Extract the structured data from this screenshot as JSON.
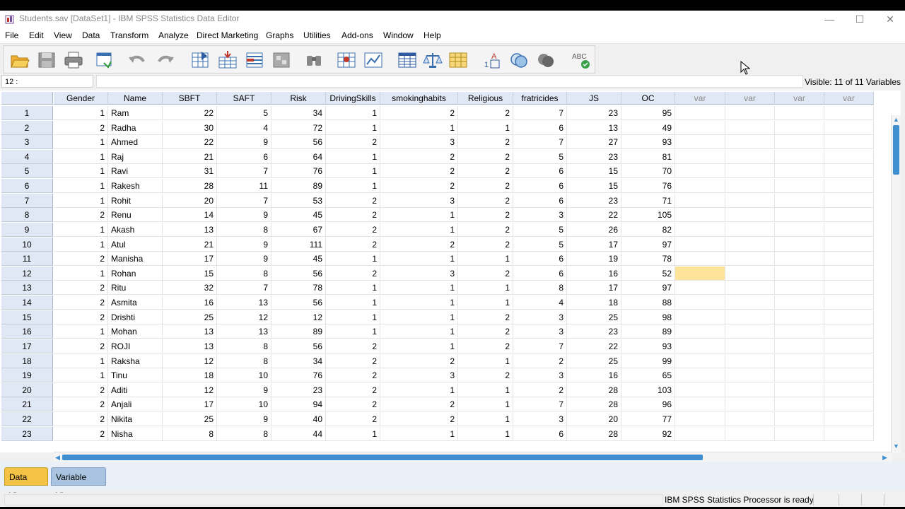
{
  "window": {
    "title": "Students.sav [DataSet1] - IBM SPSS Statistics Data Editor",
    "minimize": "—",
    "maximize": "☐",
    "close": "✕"
  },
  "menu": [
    "File",
    "Edit",
    "View",
    "Data",
    "Transform",
    "Analyze",
    "Direct Marketing",
    "Graphs",
    "Utilities",
    "Add-ons",
    "Window",
    "Help"
  ],
  "toolbar": {
    "icons": [
      "open-icon",
      "save-icon",
      "print-icon",
      "recall-dialog-icon",
      "undo-icon",
      "redo-icon",
      "goto-case-icon",
      "goto-variable-icon",
      "variables-icon",
      "run-descriptives-icon",
      "find-icon",
      "insert-cases-icon",
      "insert-variable-icon",
      "split-file-icon",
      "weight-cases-icon",
      "select-cases-icon",
      "value-labels-icon",
      "use-variable-sets-icon",
      "show-all-variables-icon",
      "spell-check-icon"
    ]
  },
  "cellbar": {
    "ref": "12 :",
    "value": "",
    "visible": "Visible: 11 of 11 Variables"
  },
  "grid": {
    "columns": [
      "Gender",
      "Name",
      "SBFT",
      "SAFT",
      "Risk",
      "DrivingSkills",
      "smokinghabits",
      "Religious",
      "fratricides",
      "JS",
      "OC",
      "var",
      "var",
      "var",
      "var"
    ],
    "rows": [
      [
        "1",
        "1",
        "Ram",
        "22",
        "5",
        "34",
        "1",
        "2",
        "2",
        "7",
        "23",
        "95"
      ],
      [
        "2",
        "2",
        "Radha",
        "30",
        "4",
        "72",
        "1",
        "1",
        "1",
        "6",
        "13",
        "49"
      ],
      [
        "3",
        "1",
        "Ahmed",
        "22",
        "9",
        "56",
        "2",
        "3",
        "2",
        "7",
        "27",
        "93"
      ],
      [
        "4",
        "1",
        "Raj",
        "21",
        "6",
        "64",
        "1",
        "2",
        "2",
        "5",
        "23",
        "81"
      ],
      [
        "5",
        "1",
        "Ravi",
        "31",
        "7",
        "76",
        "1",
        "2",
        "2",
        "6",
        "15",
        "70"
      ],
      [
        "6",
        "1",
        "Rakesh",
        "28",
        "11",
        "89",
        "1",
        "2",
        "2",
        "6",
        "15",
        "76"
      ],
      [
        "7",
        "1",
        "Rohit",
        "20",
        "7",
        "53",
        "2",
        "3",
        "2",
        "6",
        "23",
        "71"
      ],
      [
        "8",
        "2",
        "Renu",
        "14",
        "9",
        "45",
        "2",
        "1",
        "2",
        "3",
        "22",
        "105"
      ],
      [
        "9",
        "1",
        "Akash",
        "13",
        "8",
        "67",
        "2",
        "1",
        "2",
        "5",
        "26",
        "82"
      ],
      [
        "10",
        "1",
        "Atul",
        "21",
        "9",
        "111",
        "2",
        "2",
        "2",
        "5",
        "17",
        "97"
      ],
      [
        "11",
        "2",
        "Manisha",
        "17",
        "9",
        "45",
        "1",
        "1",
        "1",
        "6",
        "19",
        "78"
      ],
      [
        "12",
        "1",
        "Rohan",
        "15",
        "8",
        "56",
        "2",
        "3",
        "2",
        "6",
        "16",
        "52"
      ],
      [
        "13",
        "2",
        "Ritu",
        "32",
        "7",
        "78",
        "1",
        "1",
        "1",
        "8",
        "17",
        "97"
      ],
      [
        "14",
        "2",
        "Asmita",
        "16",
        "13",
        "56",
        "1",
        "1",
        "1",
        "4",
        "18",
        "88"
      ],
      [
        "15",
        "2",
        "Drishti",
        "25",
        "12",
        "12",
        "1",
        "1",
        "2",
        "3",
        "25",
        "98"
      ],
      [
        "16",
        "1",
        "Mohan",
        "13",
        "13",
        "89",
        "1",
        "1",
        "2",
        "3",
        "23",
        "89"
      ],
      [
        "17",
        "2",
        "ROJI",
        "13",
        "8",
        "56",
        "2",
        "1",
        "2",
        "7",
        "22",
        "93"
      ],
      [
        "18",
        "1",
        "Raksha",
        "12",
        "8",
        "34",
        "2",
        "2",
        "1",
        "2",
        "25",
        "99"
      ],
      [
        "19",
        "1",
        "Tinu",
        "18",
        "10",
        "76",
        "2",
        "3",
        "2",
        "3",
        "16",
        "65"
      ],
      [
        "20",
        "2",
        "Aditi",
        "12",
        "9",
        "23",
        "2",
        "1",
        "1",
        "2",
        "28",
        "103"
      ],
      [
        "21",
        "2",
        "Anjali",
        "17",
        "10",
        "94",
        "2",
        "2",
        "1",
        "7",
        "28",
        "96"
      ],
      [
        "22",
        "2",
        "Nikita",
        "25",
        "9",
        "40",
        "2",
        "2",
        "1",
        "3",
        "20",
        "77"
      ],
      [
        "23",
        "2",
        "Nisha",
        "8",
        "8",
        "44",
        "1",
        "1",
        "1",
        "6",
        "28",
        "92"
      ]
    ],
    "selected": {
      "row": 12,
      "column": "var"
    }
  },
  "tabs": {
    "data_view": "Data View",
    "variable_view": "Variable View"
  },
  "status": {
    "text": "IBM SPSS Statistics Processor is ready"
  },
  "colors": {
    "header_bg": "#dfe8f4",
    "selected_cell": "#fde49a",
    "active_tab": "#f4c244",
    "scroll_thumb": "#3f8fd0"
  }
}
